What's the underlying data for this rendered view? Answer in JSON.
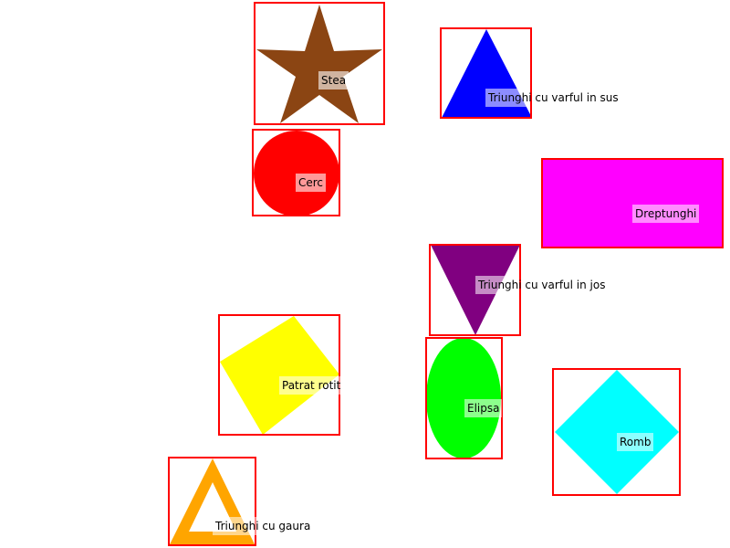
{
  "shapes": [
    {
      "id": "star",
      "label": "Stea",
      "color": "#8b4513"
    },
    {
      "id": "triangle-up",
      "label": "Triunghi cu varful in sus",
      "color": "#0000ff"
    },
    {
      "id": "circle",
      "label": "Cerc",
      "color": "#ff0000"
    },
    {
      "id": "rectangle",
      "label": "Dreptunghi",
      "color": "#ff00ff"
    },
    {
      "id": "triangle-down",
      "label": "Triunghi cu varful in jos",
      "color": "#800080"
    },
    {
      "id": "rotated-square",
      "label": "Patrat rotit",
      "color": "#ffff00"
    },
    {
      "id": "ellipse",
      "label": "Elipsa",
      "color": "#00ff00"
    },
    {
      "id": "rhombus",
      "label": "Romb",
      "color": "#00ffff"
    },
    {
      "id": "hollow-triangle",
      "label": "Triunghi cu gaura",
      "color": "#ffa500"
    }
  ],
  "bounding_box_color": "#ff0000",
  "label_background": "semi-transparent white",
  "background": "#ffffff"
}
